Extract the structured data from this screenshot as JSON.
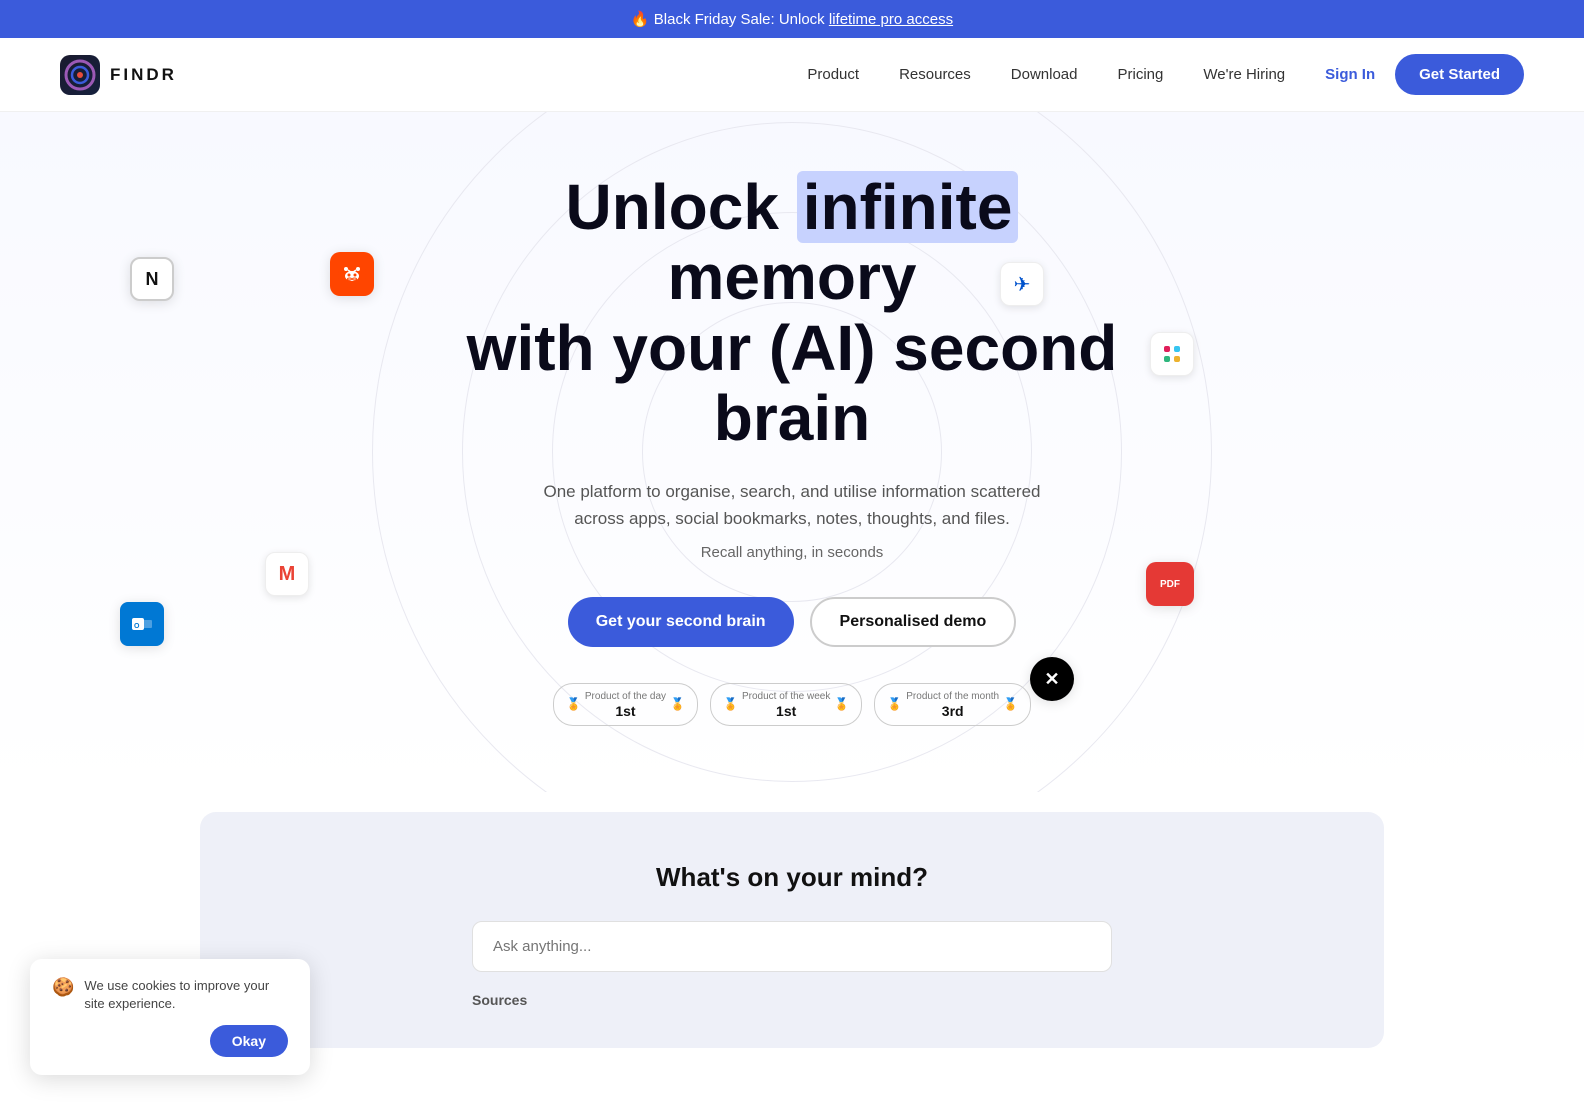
{
  "banner": {
    "fire_emoji": "🔥",
    "text": "Black Friday Sale: Unlock ",
    "link_text": "lifetime pro access"
  },
  "nav": {
    "logo_text": "FINDR",
    "links": [
      {
        "label": "Product",
        "id": "product"
      },
      {
        "label": "Resources",
        "id": "resources"
      },
      {
        "label": "Download",
        "id": "download"
      },
      {
        "label": "Pricing",
        "id": "pricing"
      },
      {
        "label": "We're Hiring",
        "id": "hiring"
      }
    ],
    "sign_in": "Sign In",
    "get_started": "Get Started"
  },
  "hero": {
    "title_part1": "Unlock ",
    "title_highlight": "infinite",
    "title_part2": " memory",
    "title_line2": "with your (AI) second brain",
    "subtitle": "One platform to organise, search, and utilise information scattered across apps, social bookmarks, notes, thoughts, and files.",
    "recall": "Recall anything, in seconds",
    "cta_primary": "Get your second brain",
    "cta_secondary": "Personalised demo",
    "awards": [
      {
        "label": "Product of the day",
        "rank": "1st"
      },
      {
        "label": "Product of the week",
        "rank": "1st"
      },
      {
        "label": "Product of the month",
        "rank": "3rd"
      }
    ]
  },
  "second_section": {
    "title": "What's on your mind?",
    "search_placeholder": "Ask anything...",
    "sources_label": "Sources"
  },
  "cookie": {
    "emoji": "🍪",
    "text": "We use cookies to improve your site experience.",
    "okay": "Okay"
  },
  "floating_icons": [
    {
      "id": "notion",
      "emoji": "N",
      "style": "background:#fff; border: 2px solid #ccc; color:#111; font-weight:800; font-size:18px; top:200px; left:130px;"
    },
    {
      "id": "reddit",
      "emoji": "🤖",
      "style": "background:#ff4500; color:#fff; top:195px; left:340px;"
    },
    {
      "id": "confluence",
      "emoji": "✈",
      "style": "background:#fff; color:#0052cc; border:1px solid #eee; top:205px; right:530px;"
    },
    {
      "id": "slack",
      "emoji": "S",
      "style": "background:#fff; border:1px solid #eee; top:270px; right:400px; font-weight:700; color:#611f69;"
    },
    {
      "id": "gmail",
      "emoji": "M",
      "style": "background:#fff; border:1px solid #eee; top:490px; left:280px; color:#ea4335; font-weight:700;"
    },
    {
      "id": "outlook",
      "emoji": "O",
      "style": "background:#0078d4; color:#fff; top:535px; left:130px; font-weight:700;"
    },
    {
      "id": "twitter",
      "emoji": "✕",
      "style": "background:#000; color:#fff; border-radius:50%; top:590px; right:520px;"
    },
    {
      "id": "pdf",
      "emoji": "PDF",
      "style": "background:#e53935; color:#fff; top:490px; right:400px; font-size:10px; font-weight:800; border-radius:10px;"
    }
  ]
}
